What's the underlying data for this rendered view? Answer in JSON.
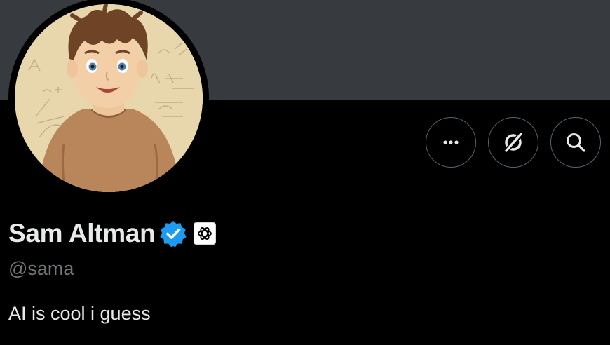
{
  "profile": {
    "display_name": "Sam Altman",
    "handle": "@sama",
    "bio": "AI is cool i guess",
    "verified_badge": "verified-check-icon",
    "affiliate_badge": "openai-logo-icon"
  },
  "actions": [
    {
      "icon": "more-dots-icon"
    },
    {
      "icon": "grok-icon"
    },
    {
      "icon": "search-icon"
    }
  ],
  "colors": {
    "banner": "#373a3e",
    "background": "#000000",
    "verified_blue": "#1d9bf0",
    "secondary_text": "#71767b",
    "border": "#536471"
  }
}
